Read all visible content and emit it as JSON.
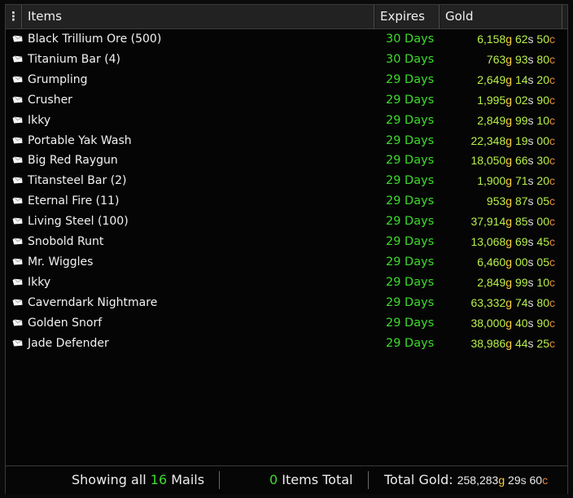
{
  "header": {
    "menu_glyph": "⋮",
    "items_label": "Items",
    "expires_label": "Expires",
    "gold_label": "Gold"
  },
  "mails": [
    {
      "name": "Black Trillium Ore (500)",
      "expires": "30 Days",
      "g": "6,158",
      "s": "62",
      "c": "50"
    },
    {
      "name": "Titanium Bar (4)",
      "expires": "30 Days",
      "g": "763",
      "s": "93",
      "c": "80"
    },
    {
      "name": "Grumpling",
      "expires": "29 Days",
      "g": "2,649",
      "s": "14",
      "c": "20"
    },
    {
      "name": "Crusher",
      "expires": "29 Days",
      "g": "1,995",
      "s": "02",
      "c": "90"
    },
    {
      "name": "Ikky",
      "expires": "29 Days",
      "g": "2,849",
      "s": "99",
      "c": "10"
    },
    {
      "name": "Portable Yak Wash",
      "expires": "29 Days",
      "g": "22,348",
      "s": "19",
      "c": "00"
    },
    {
      "name": "Big Red Raygun",
      "expires": "29 Days",
      "g": "18,050",
      "s": "66",
      "c": "30"
    },
    {
      "name": "Titansteel Bar (2)",
      "expires": "29 Days",
      "g": "1,900",
      "s": "71",
      "c": "20"
    },
    {
      "name": "Eternal Fire (11)",
      "expires": "29 Days",
      "g": "953",
      "s": "87",
      "c": "05"
    },
    {
      "name": "Living Steel (100)",
      "expires": "29 Days",
      "g": "37,914",
      "s": "85",
      "c": "00"
    },
    {
      "name": "Snobold Runt",
      "expires": "29 Days",
      "g": "13,068",
      "s": "69",
      "c": "45"
    },
    {
      "name": "Mr. Wiggles",
      "expires": "29 Days",
      "g": "6,460",
      "s": "00",
      "c": "05"
    },
    {
      "name": "Ikky",
      "expires": "29 Days",
      "g": "2,849",
      "s": "99",
      "c": "10"
    },
    {
      "name": "Caverndark Nightmare",
      "expires": "29 Days",
      "g": "63,332",
      "s": "74",
      "c": "80"
    },
    {
      "name": "Golden Snorf",
      "expires": "29 Days",
      "g": "38,000",
      "s": "40",
      "c": "90"
    },
    {
      "name": "Jade Defender",
      "expires": "29 Days",
      "g": "38,986",
      "s": "44",
      "c": "25"
    }
  ],
  "units": {
    "gold": "g",
    "silver": "s",
    "copper": "c"
  },
  "footer": {
    "showing_prefix": "Showing all",
    "mail_count": "16",
    "showing_suffix": "Mails",
    "items_count": "0",
    "items_suffix": "Items Total",
    "total_label": "Total Gold:",
    "total_g": "258,283",
    "total_s": "29",
    "total_c": "60"
  },
  "colors": {
    "expires_green": "#3ddc2c",
    "amount": "#b8f04a",
    "gold_unit": "#ffd23c",
    "silver_unit": "#dcdcdc",
    "copper_unit": "#e8883a"
  },
  "icons": {
    "row_icon": "mail-envelope-icon"
  }
}
